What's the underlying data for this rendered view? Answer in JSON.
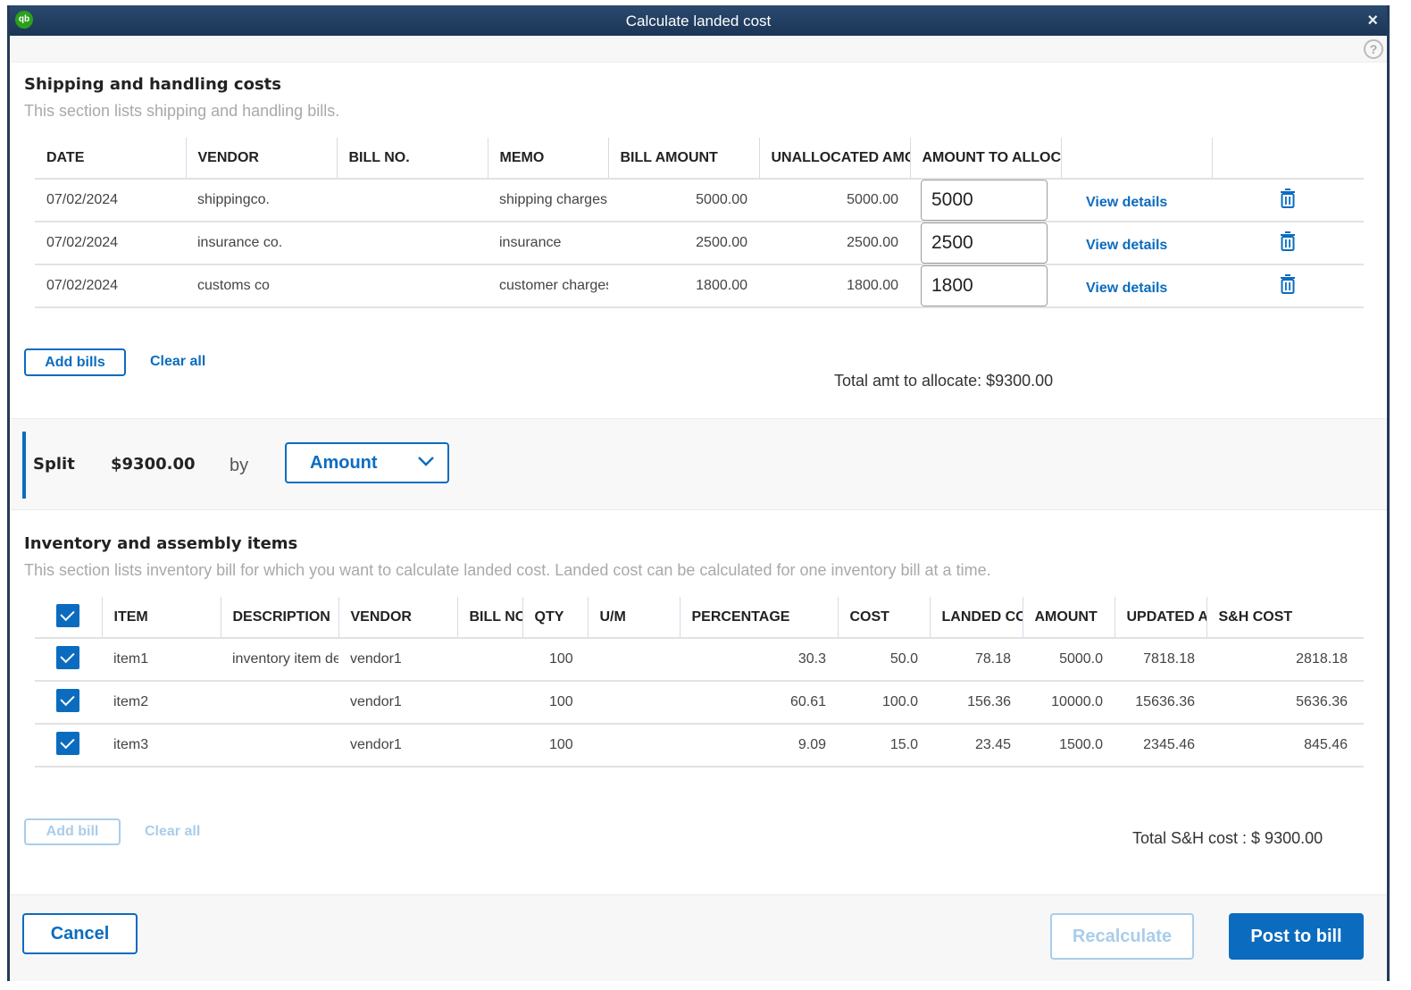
{
  "window": {
    "title": "Calculate landed cost",
    "logo_text": "qb",
    "close_icon": "×",
    "help_icon": "?"
  },
  "shipping": {
    "title": "Shipping and handling costs",
    "subtitle": "This section lists shipping and handling bills.",
    "columns": [
      "DATE",
      "VENDOR",
      "BILL NO.",
      "MEMO",
      "BILL AMOUNT",
      "UNALLOCATED AMOUNT",
      "AMOUNT TO ALLOCATE",
      "",
      ""
    ],
    "rows": [
      {
        "date": "07/02/2024",
        "vendor": "shippingco.",
        "bill_no": "",
        "memo": "shipping charges",
        "bill_amount": "5000.00",
        "unallocated": "5000.00",
        "allocate": "5000",
        "link": "View details"
      },
      {
        "date": "07/02/2024",
        "vendor": "insurance co.",
        "bill_no": "",
        "memo": "insurance",
        "bill_amount": "2500.00",
        "unallocated": "2500.00",
        "allocate": "2500",
        "link": "View details"
      },
      {
        "date": "07/02/2024",
        "vendor": "customs co",
        "bill_no": "",
        "memo": "customer charges",
        "bill_amount": "1800.00",
        "unallocated": "1800.00",
        "allocate": "1800",
        "link": "View details"
      }
    ],
    "add_bills_label": "Add bills",
    "clear_all_label": "Clear all",
    "total_label": "Total amt to allocate: $9300.00"
  },
  "split": {
    "label": "Split",
    "amount": "$9300.00",
    "by": "by",
    "method": "Amount"
  },
  "inventory": {
    "title": "Inventory and assembly items",
    "subtitle": "This section lists inventory bill for which you want to calculate landed cost. Landed cost can be calculated for one inventory bill at a time.",
    "columns": [
      "",
      "ITEM",
      "DESCRIPTION",
      "VENDOR",
      "BILL NO",
      "QTY",
      "U/M",
      "PERCENTAGE",
      "COST",
      "LANDED COST",
      "AMOUNT",
      "UPDATED AMOUNT",
      "S&H COST"
    ],
    "rows": [
      {
        "checked": true,
        "item": "item1",
        "description": "inventory item description",
        "vendor": "vendor1",
        "bill_no": "",
        "qty": "100",
        "um": "",
        "percentage": "30.3",
        "cost": "50.0",
        "landed_cost": "78.18",
        "amount": "5000.0",
        "updated_amount": "7818.18",
        "sh_cost": "2818.18"
      },
      {
        "checked": true,
        "item": "item2",
        "description": "",
        "vendor": "vendor1",
        "bill_no": "",
        "qty": "100",
        "um": "",
        "percentage": "60.61",
        "cost": "100.0",
        "landed_cost": "156.36",
        "amount": "10000.0",
        "updated_amount": "15636.36",
        "sh_cost": "5636.36"
      },
      {
        "checked": true,
        "item": "item3",
        "description": "",
        "vendor": "vendor1",
        "bill_no": "",
        "qty": "100",
        "um": "",
        "percentage": "9.09",
        "cost": "15.0",
        "landed_cost": "23.45",
        "amount": "1500.0",
        "updated_amount": "2345.46",
        "sh_cost": "845.46"
      }
    ],
    "add_bill_label": "Add bill",
    "clear_all_label": "Clear all",
    "total_label": "Total S&H cost : $ 9300.00"
  },
  "footer": {
    "cancel_label": "Cancel",
    "recalculate_label": "Recalculate",
    "post_label": "Post to bill"
  },
  "colors": {
    "accent": "#0b6cbf",
    "titlebar": "#1f3a5c",
    "logo": "#2ca01c"
  }
}
